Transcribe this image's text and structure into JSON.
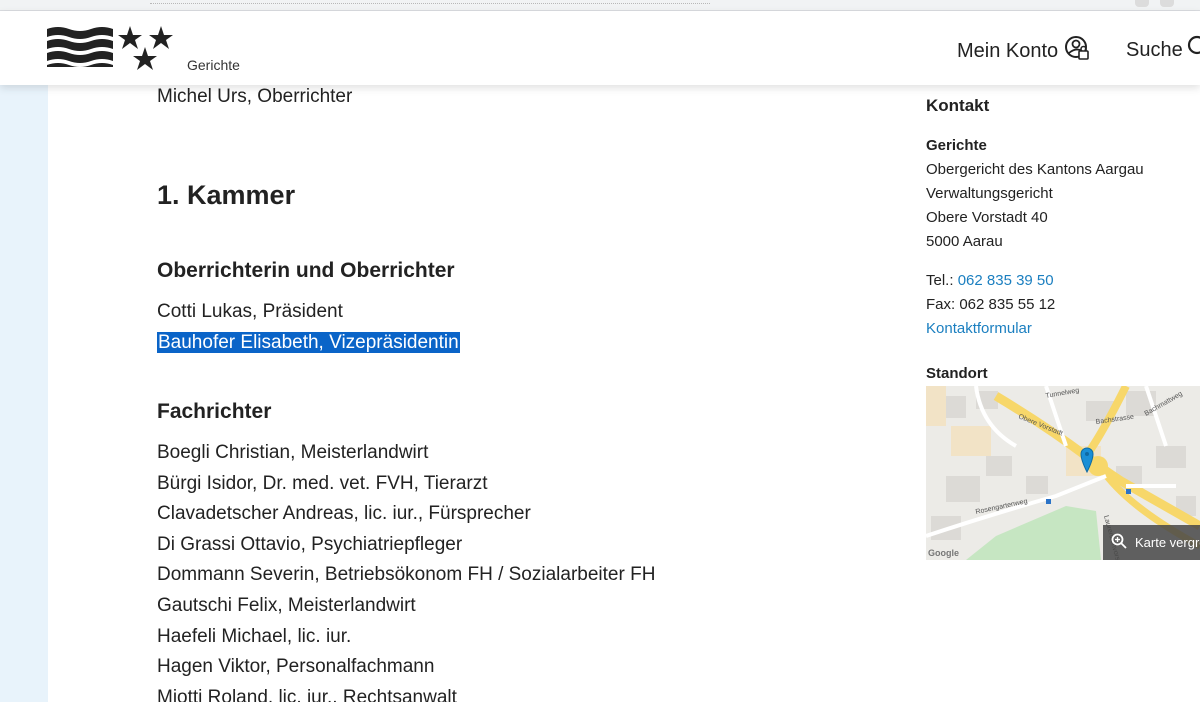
{
  "header": {
    "logo_subtitle": "Gerichte",
    "account_label": "Mein Konto",
    "search_label": "Suche"
  },
  "main": {
    "top_line": "Michel Urs, Oberrichter",
    "chamber_heading": "1. Kammer",
    "section1_heading": "Oberrichterin und Oberrichter",
    "section1_items": [
      "Cotti Lukas, Präsident",
      "Bauhofer Elisabeth, Vizepräsidentin"
    ],
    "section2_heading": "Fachrichter",
    "section2_items": [
      "Boegli Christian, Meisterlandwirt",
      "Bürgi Isidor, Dr. med. vet. FVH, Tierarzt",
      "Clavadetscher Andreas, lic. iur., Fürsprecher",
      "Di Grassi Ottavio, Psychiatriepfleger",
      "Dommann Severin, Betriebsökonom FH / Sozialarbeiter FH",
      "Gautschi Felix, Meisterlandwirt",
      "Haefeli Michael, lic. iur.",
      "Hagen Viktor, Personalfachmann",
      "Miotti Roland, lic. iur., Rechtsanwalt"
    ]
  },
  "sidebar": {
    "title": "Kontakt",
    "subtitle": "Gerichte",
    "address": [
      "Obergericht des Kantons Aargau",
      "Verwaltungsgericht",
      "Obere Vorstadt 40",
      "5000 Aarau"
    ],
    "tel_label": "Tel.:",
    "tel_value": "062 835 39 50",
    "fax": "Fax: 062 835 55 12",
    "contact_form": "Kontaktformular",
    "location_title": "Standort",
    "map_button": "Karte vergrö",
    "map_provider": "Google",
    "map_streets": [
      "Obere Vorstadt",
      "Tunnelweg",
      "Bachstrasse",
      "Bachmattweg",
      "Rosengartenweg",
      "Laurenzenvorstadt"
    ]
  },
  "colors": {
    "link": "#1b7fc0",
    "selection": "#0a64c8",
    "left_strip": "#e8f3fb",
    "map_marker": "#1a8fd6"
  }
}
